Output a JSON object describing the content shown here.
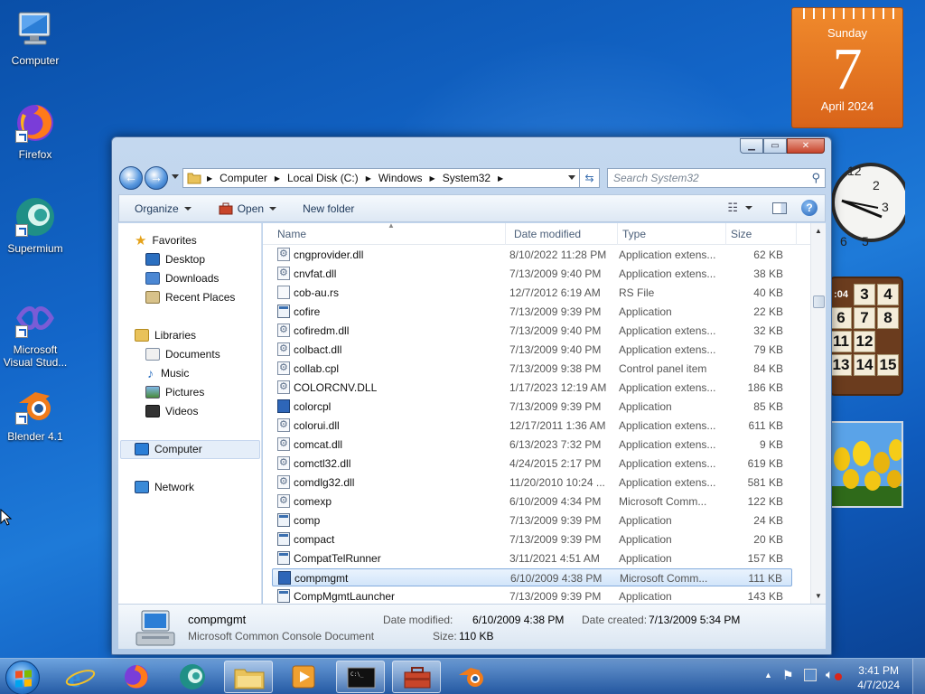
{
  "desktop": {
    "icons": [
      {
        "label": "Computer"
      },
      {
        "label": "Firefox"
      },
      {
        "label": "Supermium"
      },
      {
        "label": "Microsoft Visual Stud..."
      },
      {
        "label": "Blender 4.1"
      }
    ]
  },
  "gadgets": {
    "calendar": {
      "weekday": "Sunday",
      "day": "7",
      "month_year": "April 2024"
    },
    "puzzle": {
      "tiles": [
        "3",
        "4",
        "6",
        "7",
        "8",
        "11",
        "12",
        "",
        "13",
        "14",
        "15"
      ],
      "corner_label": ":04"
    }
  },
  "window": {
    "title": "System32",
    "breadcrumb": [
      "Computer",
      "Local Disk (C:)",
      "Windows",
      "System32"
    ],
    "search_placeholder": "Search System32",
    "toolbar": {
      "organize": "Organize",
      "open": "Open",
      "new_folder": "New folder"
    },
    "nav": {
      "favorites": "Favorites",
      "favorites_items": [
        "Desktop",
        "Downloads",
        "Recent Places"
      ],
      "libraries": "Libraries",
      "libraries_items": [
        "Documents",
        "Music",
        "Pictures",
        "Videos"
      ],
      "computer": "Computer",
      "network": "Network"
    },
    "columns": {
      "name": "Name",
      "date": "Date modified",
      "type": "Type",
      "size": "Size"
    },
    "files": [
      {
        "name": "cngprovider.dll",
        "date": "8/10/2022 11:28 PM",
        "type": "Application extens...",
        "size": "62 KB",
        "icon": "dll"
      },
      {
        "name": "cnvfat.dll",
        "date": "7/13/2009 9:40 PM",
        "type": "Application extens...",
        "size": "38 KB",
        "icon": "dll"
      },
      {
        "name": "cob-au.rs",
        "date": "12/7/2012 6:19 AM",
        "type": "RS File",
        "size": "40 KB",
        "icon": "file"
      },
      {
        "name": "cofire",
        "date": "7/13/2009 9:39 PM",
        "type": "Application",
        "size": "22 KB",
        "icon": "app"
      },
      {
        "name": "cofiredm.dll",
        "date": "7/13/2009 9:40 PM",
        "type": "Application extens...",
        "size": "32 KB",
        "icon": "dll"
      },
      {
        "name": "colbact.dll",
        "date": "7/13/2009 9:40 PM",
        "type": "Application extens...",
        "size": "79 KB",
        "icon": "dll"
      },
      {
        "name": "collab.cpl",
        "date": "7/13/2009 9:38 PM",
        "type": "Control panel item",
        "size": "84 KB",
        "icon": "dll"
      },
      {
        "name": "COLORCNV.DLL",
        "date": "1/17/2023 12:19 AM",
        "type": "Application extens...",
        "size": "186 KB",
        "icon": "dll"
      },
      {
        "name": "colorcpl",
        "date": "7/13/2009 9:39 PM",
        "type": "Application",
        "size": "85 KB",
        "icon": "mmc"
      },
      {
        "name": "colorui.dll",
        "date": "12/17/2011 1:36 AM",
        "type": "Application extens...",
        "size": "611 KB",
        "icon": "dll"
      },
      {
        "name": "comcat.dll",
        "date": "6/13/2023 7:32 PM",
        "type": "Application extens...",
        "size": "9 KB",
        "icon": "dll"
      },
      {
        "name": "comctl32.dll",
        "date": "4/24/2015 2:17 PM",
        "type": "Application extens...",
        "size": "619 KB",
        "icon": "dll"
      },
      {
        "name": "comdlg32.dll",
        "date": "11/20/2010 10:24 ...",
        "type": "Application extens...",
        "size": "581 KB",
        "icon": "dll"
      },
      {
        "name": "comexp",
        "date": "6/10/2009 4:34 PM",
        "type": "Microsoft Comm...",
        "size": "122 KB",
        "icon": "dll"
      },
      {
        "name": "comp",
        "date": "7/13/2009 9:39 PM",
        "type": "Application",
        "size": "24 KB",
        "icon": "app"
      },
      {
        "name": "compact",
        "date": "7/13/2009 9:39 PM",
        "type": "Application",
        "size": "20 KB",
        "icon": "app"
      },
      {
        "name": "CompatTelRunner",
        "date": "3/11/2021 4:51 AM",
        "type": "Application",
        "size": "157 KB",
        "icon": "app"
      },
      {
        "name": "compmgmt",
        "date": "6/10/2009 4:38 PM",
        "type": "Microsoft Comm...",
        "size": "111 KB",
        "icon": "mmc",
        "selected": true
      },
      {
        "name": "CompMgmtLauncher",
        "date": "7/13/2009 9:39 PM",
        "type": "Application",
        "size": "143 KB",
        "icon": "app"
      }
    ],
    "details": {
      "name": "compmgmt",
      "type": "Microsoft Common Console Document",
      "modified_label": "Date modified:",
      "modified": "6/10/2009 4:38 PM",
      "created_label": "Date created:",
      "created": "7/13/2009 5:34 PM",
      "size_label": "Size:",
      "size": "110 KB"
    }
  },
  "taskbar": {
    "time": "3:41 PM",
    "date": "4/7/2024"
  },
  "colors": {
    "selection": "#d2e5fa",
    "accent": "#1e7ad8"
  }
}
